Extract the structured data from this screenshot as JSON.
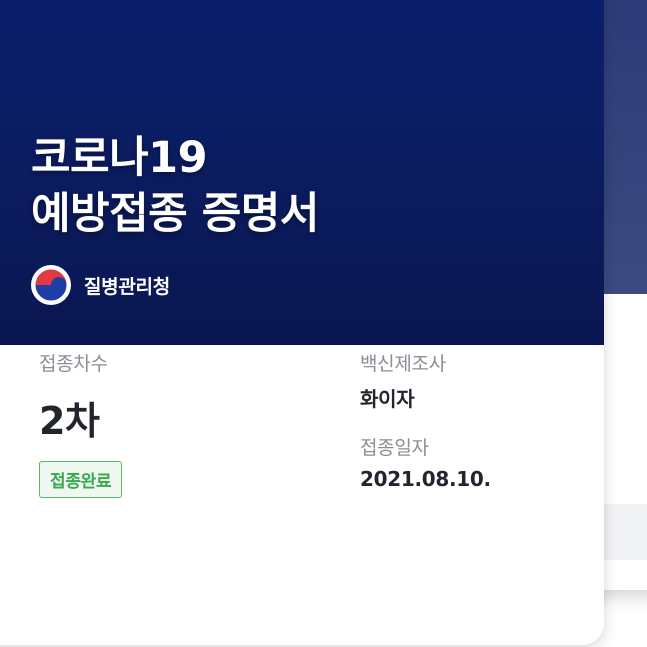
{
  "certificate": {
    "title_line1": "코로나19",
    "title_line2": "예방접종 증명서",
    "agency_name": "질병관리청",
    "emblem_icon": "taegeuk-emblem-icon",
    "dose_label": "접종차수",
    "dose_value": "2차",
    "status_badge": "접종완료",
    "manufacturer_label": "백신제조사",
    "manufacturer_value": "화이자",
    "date_label": "접종일자",
    "date_value": "2021.08.10."
  },
  "colors": {
    "header_navy": "#0b1d62",
    "badge_green": "#3aa851",
    "label_gray": "#8b8e96",
    "value_dark": "#22252d"
  }
}
